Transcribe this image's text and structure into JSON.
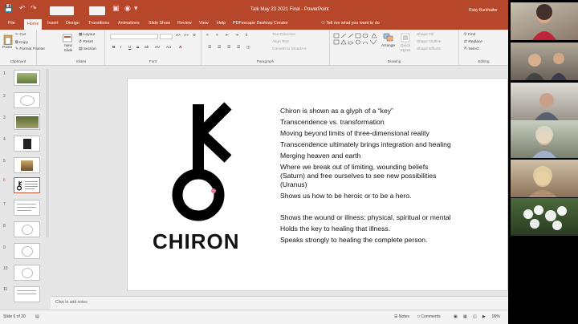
{
  "window": {
    "title": "Talk May 23 2021 Final  -  PowerPoint",
    "user": "Ruby Burkhalter"
  },
  "tabs": [
    "File",
    "Home",
    "Insert",
    "Design",
    "Transitions",
    "Animations",
    "Slide Show",
    "Review",
    "View",
    "Help",
    "PDFescape Desktop Creator"
  ],
  "tell_me": "Tell me what you want to do",
  "ribbon": {
    "clipboard": {
      "label": "Clipboard",
      "paste": "Paste",
      "cut": "Cut",
      "copy": "Copy",
      "format_painter": "Format Painter"
    },
    "slides": {
      "label": "Slides",
      "new_slide": "New Slide",
      "layout": "Layout",
      "reset": "Reset",
      "section": "Section"
    },
    "font": {
      "label": "Font",
      "buttons": [
        "B",
        "I",
        "U",
        "S",
        "ab",
        "AV",
        "Aa",
        "A"
      ]
    },
    "paragraph": {
      "label": "Paragraph",
      "text_direction": "Text Direction",
      "align_text": "Align Text",
      "smartart": "Convert to SmartArt"
    },
    "drawing": {
      "label": "Drawing",
      "arrange": "Arrange",
      "quick_styles": "Quick Styles",
      "shape_fill": "Shape Fill",
      "shape_outline": "Shape Outline",
      "shape_effects": "Shape Effects"
    },
    "editing": {
      "label": "Editing",
      "find": "Find",
      "replace": "Replace",
      "select": "Select"
    }
  },
  "thumbnails": [
    "1",
    "2",
    "3",
    "4",
    "5",
    "6",
    "7",
    "8",
    "9",
    "10",
    "11"
  ],
  "active_slide": "6",
  "slide": {
    "logo_text": "CHIRON",
    "bullets": [
      "Chiron is shown as a glyph of a “key”",
      "Transcendence vs. transformation",
      "Moving beyond limits of three-dimensional reality",
      "Transcendence ultimately brings integration and healing",
      "Merging heaven and earth",
      "Where we break out of limiting, wounding beliefs",
      "(Saturn) and free ourselves to see new possibilities",
      "(Uranus)",
      "Shows us how to be heroic or to be a hero.",
      "Shows the wound or illness: physical, spiritual or mental",
      "Holds the key to healing that illness.",
      "Speaks strongly to healing the complete person."
    ]
  },
  "notes_placeholder": "Click to add notes",
  "status": {
    "slide_of": "Slide 6 of 20",
    "notes": "Notes",
    "comments": "Comments",
    "zoom": "99%"
  },
  "colors": {
    "accent": "#b7472a",
    "slide_bg": "#ffffff",
    "app_bg": "#e6e6e6"
  }
}
